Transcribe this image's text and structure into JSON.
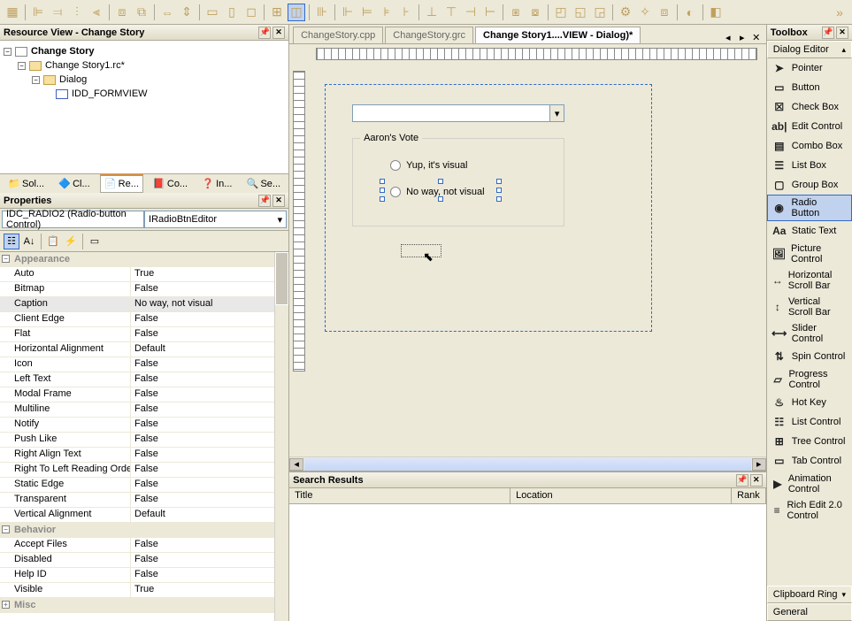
{
  "resourceView": {
    "title": "Resource View - Change Story",
    "tree": {
      "root": "Change Story",
      "rc": "Change Story1.rc*",
      "dialog": "Dialog",
      "form": "IDD_FORMVIEW"
    }
  },
  "bottomTabs": {
    "sol": "Sol...",
    "cl": "Cl...",
    "re": "Re...",
    "co": "Co...",
    "in": "In...",
    "se": "Se..."
  },
  "properties": {
    "title": "Properties",
    "selector": "IDC_RADIO2 (Radio-button Control)",
    "editor": "IRadioBtnEditor",
    "cat_appearance": "Appearance",
    "cat_behavior": "Behavior",
    "cat_misc": "Misc",
    "rows": [
      {
        "name": "Auto",
        "val": "True"
      },
      {
        "name": "Bitmap",
        "val": "False"
      },
      {
        "name": "Caption",
        "val": "No way, not visual"
      },
      {
        "name": "Client Edge",
        "val": "False"
      },
      {
        "name": "Flat",
        "val": "False"
      },
      {
        "name": "Horizontal Alignment",
        "val": "Default"
      },
      {
        "name": "Icon",
        "val": "False"
      },
      {
        "name": "Left Text",
        "val": "False"
      },
      {
        "name": "Modal Frame",
        "val": "False"
      },
      {
        "name": "Multiline",
        "val": "False"
      },
      {
        "name": "Notify",
        "val": "False"
      },
      {
        "name": "Push Like",
        "val": "False"
      },
      {
        "name": "Right Align Text",
        "val": "False"
      },
      {
        "name": "Right To Left Reading Order",
        "val": "False"
      },
      {
        "name": "Static Edge",
        "val": "False"
      },
      {
        "name": "Transparent",
        "val": "False"
      },
      {
        "name": "Vertical Alignment",
        "val": "Default"
      }
    ],
    "behavior_rows": [
      {
        "name": "Accept Files",
        "val": "False"
      },
      {
        "name": "Disabled",
        "val": "False"
      },
      {
        "name": "Help ID",
        "val": "False"
      },
      {
        "name": "Visible",
        "val": "True"
      }
    ]
  },
  "docTabs": {
    "t1": "ChangeStory.cpp",
    "t2": "ChangeStory.grc",
    "t3": "Change Story1....VIEW - Dialog)*"
  },
  "canvas": {
    "group_title": "Aaron's Vote",
    "radio1": "Yup, it's visual",
    "radio2": "No way, not visual"
  },
  "search": {
    "title": "Search Results",
    "col_title": "Title",
    "col_location": "Location",
    "col_rank": "Rank"
  },
  "toolbox": {
    "title": "Toolbox",
    "cat": "Dialog Editor",
    "clipboard": "Clipboard Ring",
    "general": "General",
    "items": [
      "Pointer",
      "Button",
      "Check Box",
      "Edit Control",
      "Combo Box",
      "List Box",
      "Group Box",
      "Radio Button",
      "Static Text",
      "Picture Control",
      "Horizontal Scroll Bar",
      "Vertical Scroll Bar",
      "Slider Control",
      "Spin Control",
      "Progress Control",
      "Hot Key",
      "List Control",
      "Tree Control",
      "Tab Control",
      "Animation Control",
      "Rich Edit 2.0 Control"
    ]
  }
}
